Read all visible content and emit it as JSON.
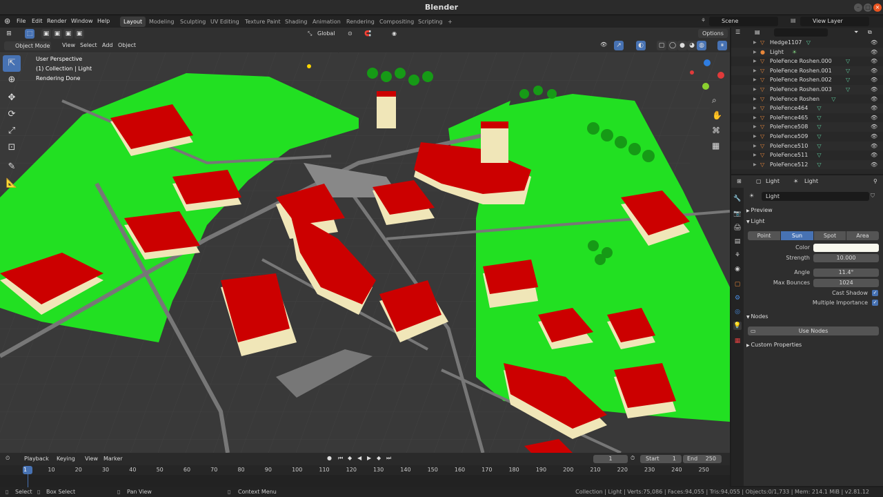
{
  "window": {
    "title": "Blender"
  },
  "menu": [
    "File",
    "Edit",
    "Render",
    "Window",
    "Help"
  ],
  "workspaces": [
    "Layout",
    "Modeling",
    "Sculpting",
    "UV Editing",
    "Texture Paint",
    "Shading",
    "Animation",
    "Rendering",
    "Compositing",
    "Scripting"
  ],
  "scene": {
    "name": "Scene",
    "view_layer": "View Layer"
  },
  "header": {
    "mode": "Object Mode",
    "view": "View",
    "select": "Select",
    "add": "Add",
    "object": "Object",
    "transform": "Global",
    "options": "Options"
  },
  "viewport": {
    "perspective": "User Perspective",
    "collection": "(1) Collection | Light",
    "status": "Rendering Done"
  },
  "outliner": {
    "search_placeholder": "",
    "items": [
      "Hedge1107",
      "Light",
      "PoleFence Roshen.000",
      "PoleFence Roshen.001",
      "PoleFence Roshen.002",
      "PoleFence Roshen.003",
      "PoleFence Roshen",
      "PoleFence464",
      "PoleFence465",
      "PoleFence508",
      "PoleFence509",
      "PoleFence510",
      "PoleFence511",
      "PoleFence512"
    ]
  },
  "properties": {
    "breadcrumb_object": "Light",
    "breadcrumb_data": "Light",
    "data_name": "Light",
    "preview": "Preview",
    "light_section": "Light",
    "types": [
      "Point",
      "Sun",
      "Spot",
      "Area"
    ],
    "active_type": "Sun",
    "color_label": "Color",
    "color_value": "#f8f8ee",
    "strength_label": "Strength",
    "strength": "10.000",
    "angle_label": "Angle",
    "angle": "11.4°",
    "max_bounces_label": "Max Bounces",
    "max_bounces": "1024",
    "cast_shadow": "Cast Shadow",
    "multiple_importance": "Multiple Importance",
    "nodes_section": "Nodes",
    "use_nodes": "Use Nodes",
    "custom_props": "Custom Properties"
  },
  "timeline": {
    "playback": "Playback",
    "keying": "Keying",
    "view": "View",
    "marker": "Marker",
    "current_frame": "1",
    "start_label": "Start",
    "start": "1",
    "end_label": "End",
    "end": "250",
    "ticks": [
      "1",
      "10",
      "20",
      "30",
      "40",
      "50",
      "60",
      "70",
      "80",
      "90",
      "100",
      "110",
      "120",
      "130",
      "140",
      "150",
      "160",
      "170",
      "180",
      "190",
      "200",
      "210",
      "220",
      "230",
      "240",
      "250"
    ]
  },
  "statusbar": {
    "select": "Select",
    "box_select": "Box Select",
    "pan_view": "Pan View",
    "context_menu": "Context Menu",
    "stats": "Collection | Light | Verts:75,086 | Faces:94,055 | Tris:94,055 | Objects:0/1,733 | Mem: 214.1 MiB | v2.81.12"
  },
  "colors": {
    "accent": "#4772b3",
    "roof": "#cc0000",
    "wall": "#f0e6b8",
    "grass": "#22e022",
    "ground": "#3a3a3a"
  }
}
